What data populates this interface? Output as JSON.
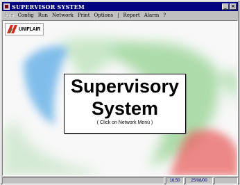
{
  "window": {
    "title": "SUPERVISOR SYSTEM",
    "controls": {
      "minimize": "_",
      "close": "×"
    }
  },
  "menu": {
    "file": {
      "label": "File",
      "disabled": true
    },
    "config": "Config",
    "run": "Run",
    "network": "Network",
    "print": "Print",
    "options": "Options",
    "separator": "|",
    "report": "Report",
    "alarm": "Alarm",
    "help": "?"
  },
  "logo": {
    "text": "UNIFLAIR",
    "colors": {
      "red": "#e0261c",
      "green": "#2a8a3a"
    }
  },
  "hero": {
    "line1": "Supervisory",
    "line2": "System",
    "hint": "( Click on Network Menù )"
  },
  "statusbar": {
    "time": "16.50",
    "date": "25/08/00"
  },
  "colors": {
    "titlebar": "#000080",
    "swoosh_green": "#58b85a",
    "swoosh_blue": "#6ab0e8",
    "swoosh_red": "#e86060"
  }
}
